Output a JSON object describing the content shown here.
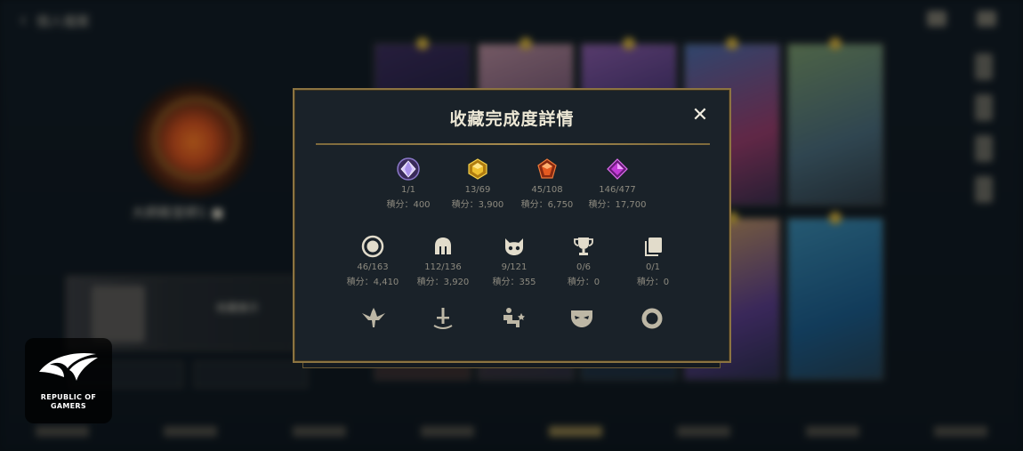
{
  "background": {
    "back_label": "個人檔案",
    "player_name": "大師殿堂師1 ■",
    "banner_label": "收藏展示"
  },
  "modal": {
    "title": "收藏完成度詳情",
    "close_label": "✕",
    "gem_stats": [
      {
        "icon": "purple-diamond-gem-icon",
        "color": "#cdb8ff",
        "count": "1/1",
        "score": "積分：400"
      },
      {
        "icon": "gold-gem-icon",
        "color": "#e8b21c",
        "count": "13/69",
        "score": "積分：3,900"
      },
      {
        "icon": "orange-gem-icon",
        "color": "#e0602a",
        "count": "45/108",
        "score": "積分：6,750"
      },
      {
        "icon": "magenta-diamond-gem-icon",
        "color": "#c23ad6",
        "count": "146/477",
        "score": "積分：17,700"
      }
    ],
    "item_stats": [
      {
        "icon": "orb-icon",
        "count": "46/163",
        "score": "積分：4,410"
      },
      {
        "icon": "helmet-icon",
        "count": "112/136",
        "score": "積分：3,920"
      },
      {
        "icon": "creature-icon",
        "count": "9/121",
        "score": "積分：355"
      },
      {
        "icon": "trophy-icon",
        "count": "0/6",
        "score": "積分：0"
      },
      {
        "icon": "cards-stack-icon",
        "count": "0/1",
        "score": "積分：0"
      }
    ],
    "bottom_badges": [
      "winged-emblem-icon",
      "sword-icon",
      "rider-icon",
      "mask-icon",
      "ring-icon"
    ]
  },
  "rog": {
    "text": "REPUBLIC OF\nGAMERS"
  }
}
